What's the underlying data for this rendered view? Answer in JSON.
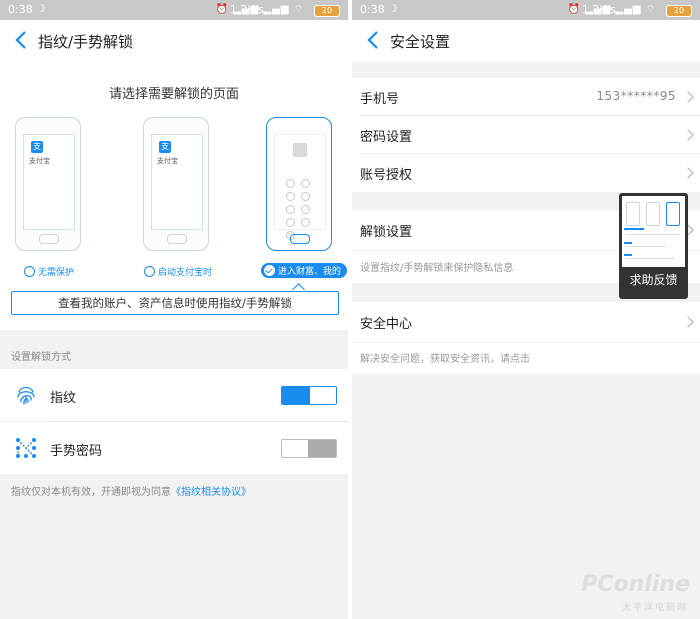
{
  "status_bar": {
    "time": "0:38",
    "network_speed": "1.2K/s",
    "battery": "20"
  },
  "left": {
    "title": "指纹/手势解锁",
    "select_title": "请选择需要解锁的页面",
    "app_label": "支付宝",
    "app_icon_glyph": "支",
    "options": [
      {
        "label": "无需保护",
        "selected": false
      },
      {
        "label": "启动支付宝时",
        "selected": false
      },
      {
        "label": "进入财富、我的",
        "selected": true
      }
    ],
    "hint": "查看我的账户、资产信息时使用指纹/手势解锁",
    "section_label": "设置解锁方式",
    "methods": [
      {
        "label": "指纹",
        "icon": "fingerprint-icon",
        "enabled": true
      },
      {
        "label": "手势密码",
        "icon": "gesture-pattern-icon",
        "enabled": false
      }
    ],
    "agreement_text": "指纹仅对本机有效，开通即视为同意",
    "agreement_link": "《指纹相关协议》"
  },
  "right": {
    "title": "安全设置",
    "phone_label": "手机号",
    "phone_value": "153******95",
    "password_label": "密码设置",
    "auth_label": "账号授权",
    "unlock_label": "解锁设置",
    "unlock_desc": "设置指纹/手势解锁来保护隐私信息",
    "center_label": "安全中心",
    "center_desc": "解决安全问题，获取安全资讯，请点击",
    "feedback_label": "求助反馈"
  },
  "watermark": {
    "brand": "PConline",
    "sub": "太平洋电脑网"
  },
  "colors": {
    "accent": "#1a8cf0",
    "status_bar": "#c8c8c8",
    "background": "#f2f2f2"
  }
}
